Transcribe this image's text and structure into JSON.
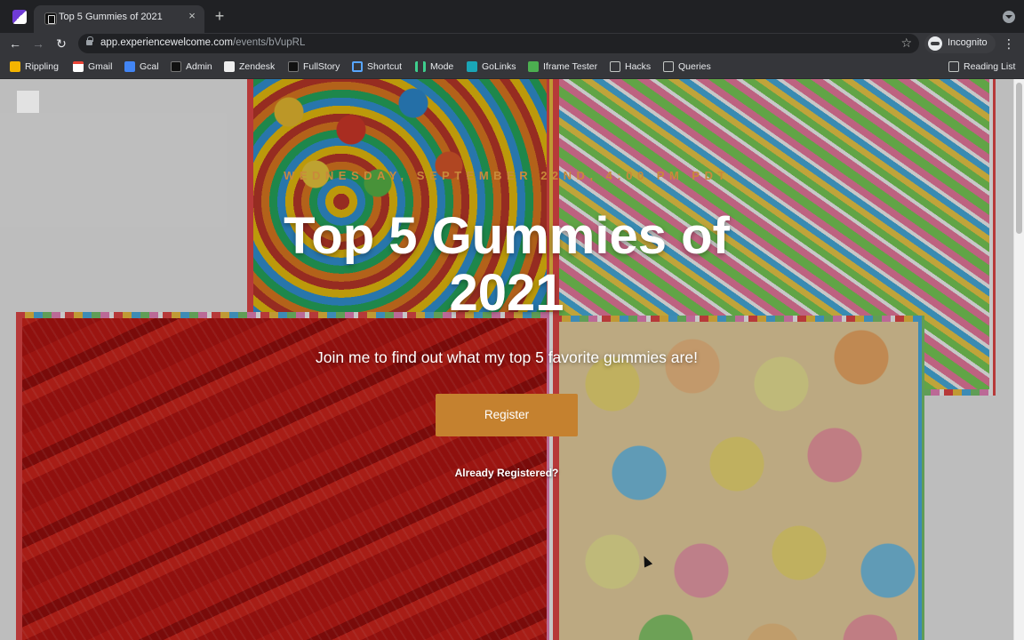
{
  "browser": {
    "tab": {
      "title": "Top 5 Gummies of 2021",
      "close_glyph": "×"
    },
    "new_tab_glyph": "+",
    "url": {
      "host": "app.experiencewelcome.com",
      "path": "/events/bVupRL"
    },
    "profile_label": "Incognito",
    "bookmarks": [
      {
        "label": "Rippling",
        "icon": "rippling-icon"
      },
      {
        "label": "Gmail",
        "icon": "gmail-icon"
      },
      {
        "label": "Gcal",
        "icon": "gcal-icon"
      },
      {
        "label": "Admin",
        "icon": "admin-icon"
      },
      {
        "label": "Zendesk",
        "icon": "zendesk-icon"
      },
      {
        "label": "FullStory",
        "icon": "fullstory-icon"
      },
      {
        "label": "Shortcut",
        "icon": "shortcut-icon"
      },
      {
        "label": "Mode",
        "icon": "mode-icon"
      },
      {
        "label": "GoLinks",
        "icon": "golinks-icon"
      },
      {
        "label": "Iframe Tester",
        "icon": "iframe-tester-icon"
      },
      {
        "label": "Hacks",
        "icon": "folder-icon"
      },
      {
        "label": "Queries",
        "icon": "folder-icon"
      }
    ],
    "reading_list_label": "Reading List"
  },
  "event": {
    "date": "WEDNESDAY, SEPTEMBER 22ND, 4:00 PM PDT",
    "title": "Top 5 Gummies of 2021",
    "subtitle": "Join me to find out what my top 5 favorite gummies are!",
    "register_label": "Register",
    "already_registered_label": "Already Registered?"
  },
  "colors": {
    "accent": "#c5812f",
    "chrome_bg": "#202124",
    "toolbar_bg": "#35363a"
  }
}
